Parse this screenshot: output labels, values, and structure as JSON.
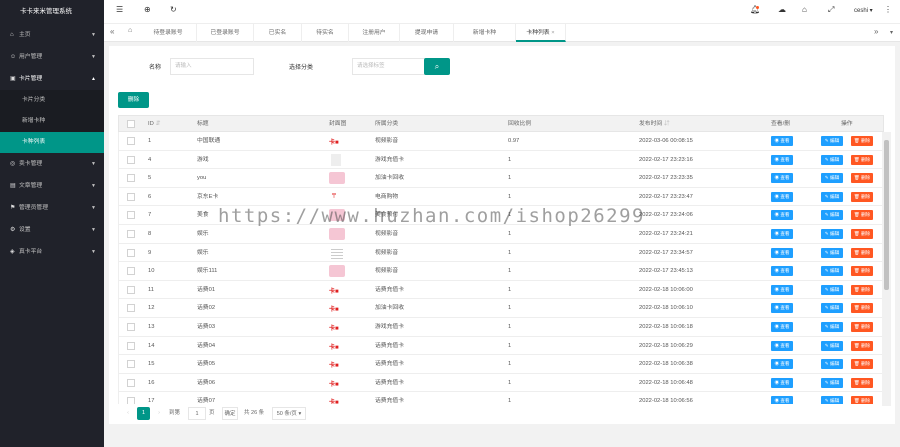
{
  "app": {
    "title": "卡卡来米管理系统"
  },
  "sidebar": {
    "items": [
      {
        "label": "主页",
        "icon": "home-icon"
      },
      {
        "label": "用户管理",
        "icon": "user-icon"
      },
      {
        "label": "卡片管理",
        "icon": "card-icon",
        "open": true,
        "children": [
          "卡片分类",
          "新增卡种",
          "卡种列表"
        ],
        "active": "卡种列表"
      },
      {
        "label": "卖卡管理",
        "icon": "sell-icon"
      },
      {
        "label": "文章管理",
        "icon": "article-icon"
      },
      {
        "label": "管理员管理",
        "icon": "admin-icon"
      },
      {
        "label": "设置",
        "icon": "settings-icon"
      },
      {
        "label": "真卡平台",
        "icon": "platform-icon"
      }
    ]
  },
  "topbar": {
    "user": "ceshi"
  },
  "tabs": [
    "待登录账号",
    "已登录账号",
    "已实名",
    "待实名",
    "注册用户",
    "提现申请",
    "新增卡种",
    "卡种列表"
  ],
  "tabs_active": "卡种列表",
  "filters": {
    "name_label": "名称",
    "name_placeholder": "请输入",
    "category_label": "选择分类",
    "category_placeholder": "请选择标签"
  },
  "delete_button": "删除",
  "table": {
    "headers": [
      "ID",
      "标题",
      "封面图",
      "所属分类",
      "回收比例",
      "发布时间",
      "查看/删",
      "操作"
    ],
    "view_label": "查看",
    "edit_label": "编辑",
    "delete_label": "删除",
    "rows": [
      {
        "id": "1",
        "title": "中国联通",
        "category": "视频影音",
        "ratio": "0.97",
        "time": "2022-03-06 00:08:15",
        "thumb": "red"
      },
      {
        "id": "4",
        "title": "游戏",
        "category": "游戏充值卡",
        "ratio": "1",
        "time": "2022-02-17 23:23:16",
        "thumb": "none"
      },
      {
        "id": "5",
        "title": "you",
        "category": "加油卡回收",
        "ratio": "1",
        "time": "2022-02-17 23:23:35",
        "thumb": "pink"
      },
      {
        "id": "6",
        "title": "京东E卡",
        "category": "电商购物",
        "ratio": "1",
        "time": "2022-02-17 23:23:47",
        "thumb": "red2"
      },
      {
        "id": "7",
        "title": "美食",
        "category": "美食预付",
        "ratio": "1",
        "time": "2022-02-17 23:24:06",
        "thumb": "pink"
      },
      {
        "id": "8",
        "title": "娱乐",
        "category": "视频影音",
        "ratio": "1",
        "time": "2022-02-17 23:24:21",
        "thumb": "pink"
      },
      {
        "id": "9",
        "title": "娱乐",
        "category": "视频影音",
        "ratio": "1",
        "time": "2022-02-17 23:34:57",
        "thumb": "grid"
      },
      {
        "id": "10",
        "title": "娱乐111",
        "category": "视频影音",
        "ratio": "1",
        "time": "2022-02-17 23:45:13",
        "thumb": "pink"
      },
      {
        "id": "11",
        "title": "话费01",
        "category": "话费充值卡",
        "ratio": "1",
        "time": "2022-02-18 10:06:00",
        "thumb": "red"
      },
      {
        "id": "12",
        "title": "话费02",
        "category": "加油卡回收",
        "ratio": "1",
        "time": "2022-02-18 10:06:10",
        "thumb": "red"
      },
      {
        "id": "13",
        "title": "话费03",
        "category": "游戏充值卡",
        "ratio": "1",
        "time": "2022-02-18 10:06:18",
        "thumb": "red"
      },
      {
        "id": "14",
        "title": "话费04",
        "category": "话费充值卡",
        "ratio": "1",
        "time": "2022-02-18 10:06:29",
        "thumb": "red"
      },
      {
        "id": "15",
        "title": "话费05",
        "category": "话费充值卡",
        "ratio": "1",
        "time": "2022-02-18 10:06:38",
        "thumb": "red"
      },
      {
        "id": "16",
        "title": "话费06",
        "category": "话费充值卡",
        "ratio": "1",
        "time": "2022-02-18 10:06:48",
        "thumb": "red"
      },
      {
        "id": "17",
        "title": "话费07",
        "category": "话费充值卡",
        "ratio": "1",
        "time": "2022-02-18 10:06:56",
        "thumb": "red"
      }
    ]
  },
  "pager": {
    "current": "1",
    "goto_label": "到第",
    "goto_value": "1",
    "page_unit": "页",
    "confirm": "确定",
    "total": "共 26 条",
    "per_page": "50 条/页"
  },
  "watermark": "https://www.huzhan.com/ishop26299",
  "colors": {
    "accent": "#009688",
    "sidebar": "#20222a",
    "blue": "#1e9fff",
    "orange": "#ff5722"
  }
}
